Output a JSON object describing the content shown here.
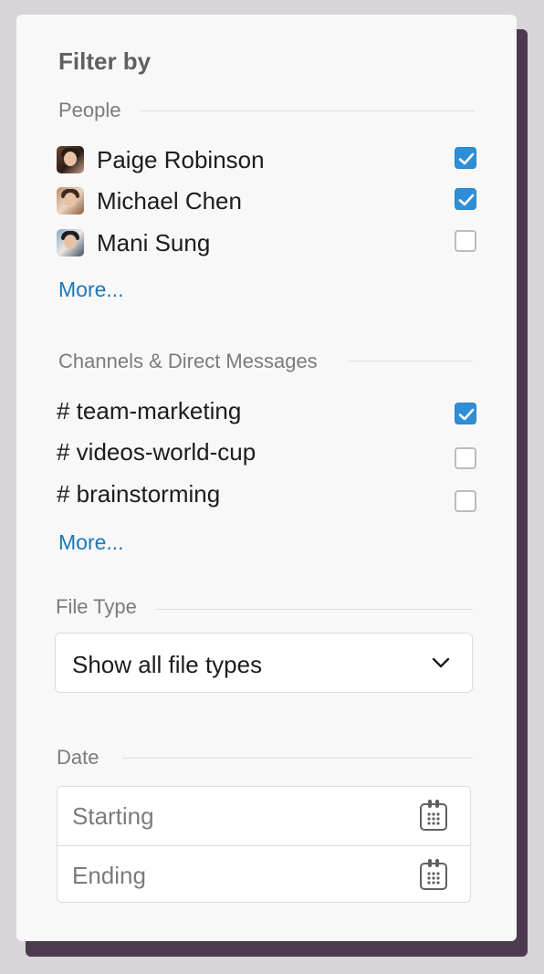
{
  "panel": {
    "title": "Filter by"
  },
  "people": {
    "label": "People",
    "items": [
      {
        "name": "Paige Robinson",
        "checked": true
      },
      {
        "name": "Michael Chen",
        "checked": true
      },
      {
        "name": "Mani Sung",
        "checked": false
      }
    ],
    "more_label": "More..."
  },
  "channels": {
    "label": "Channels & Direct Messages",
    "items": [
      {
        "name": "# team-marketing",
        "checked": true
      },
      {
        "name": "# videos-world-cup",
        "checked": false
      },
      {
        "name": "# brainstorming",
        "checked": false
      }
    ],
    "more_label": "More..."
  },
  "file_type": {
    "label": "File Type",
    "selected": "Show all file types"
  },
  "date": {
    "label": "Date",
    "start_placeholder": "Starting",
    "end_placeholder": "Ending"
  },
  "colors": {
    "checkbox_checked": "#2f8fd6",
    "link": "#1d77b4",
    "backdrop_shadow": "#4c3a4f"
  },
  "icons": [
    "check-icon",
    "chevron-down-icon",
    "calendar-icon"
  ]
}
